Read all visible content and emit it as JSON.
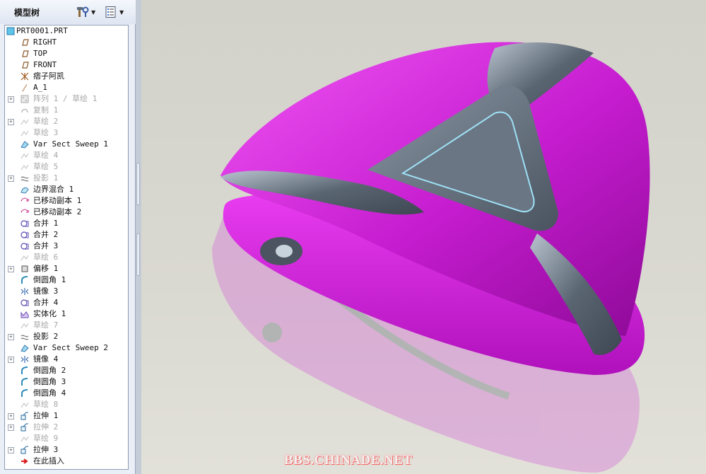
{
  "panel": {
    "title": "模型树",
    "tools": [
      {
        "name": "settings-tool",
        "icon": "hammer-gear-icon"
      },
      {
        "name": "show-tool",
        "icon": "list-icon"
      }
    ]
  },
  "tree": {
    "items": [
      {
        "label": "PRT0001.PRT",
        "icon": "part-icon",
        "dim": false,
        "expand": false,
        "root": true
      },
      {
        "label": "RIGHT",
        "icon": "datum-plane-icon",
        "dim": false,
        "expand": false
      },
      {
        "label": "TOP",
        "icon": "datum-plane-icon",
        "dim": false,
        "expand": false
      },
      {
        "label": "FRONT",
        "icon": "datum-plane-icon",
        "dim": false,
        "expand": false
      },
      {
        "label": "痞子阿凯",
        "icon": "coord-system-icon",
        "dim": false,
        "expand": false
      },
      {
        "label": "A_1",
        "icon": "datum-axis-icon",
        "dim": false,
        "expand": false
      },
      {
        "label": "阵列 1 / 草绘 1",
        "icon": "pattern-icon",
        "dim": true,
        "expand": true
      },
      {
        "label": "复制 1",
        "icon": "copy-icon",
        "dim": true,
        "expand": false
      },
      {
        "label": "草绘 2",
        "icon": "sketch-icon",
        "dim": true,
        "expand": true
      },
      {
        "label": "草绘 3",
        "icon": "sketch-icon",
        "dim": true,
        "expand": false
      },
      {
        "label": "Var Sect Sweep 1",
        "icon": "sweep-icon",
        "dim": false,
        "expand": false
      },
      {
        "label": "草绘 4",
        "icon": "sketch-icon",
        "dim": true,
        "expand": false
      },
      {
        "label": "草绘 5",
        "icon": "sketch-icon",
        "dim": true,
        "expand": false
      },
      {
        "label": "投影 1",
        "icon": "projection-icon",
        "dim": true,
        "expand": true
      },
      {
        "label": "边界混合 1",
        "icon": "boundary-blend-icon",
        "dim": false,
        "expand": false
      },
      {
        "label": "已移动副本 1",
        "icon": "moved-copy-icon",
        "dim": false,
        "expand": false
      },
      {
        "label": "已移动副本 2",
        "icon": "moved-copy-icon",
        "dim": false,
        "expand": false
      },
      {
        "label": "合并 1",
        "icon": "merge-icon",
        "dim": false,
        "expand": false
      },
      {
        "label": "合并 2",
        "icon": "merge-icon",
        "dim": false,
        "expand": false
      },
      {
        "label": "合并 3",
        "icon": "merge-icon",
        "dim": false,
        "expand": false
      },
      {
        "label": "草绘 6",
        "icon": "sketch-icon",
        "dim": true,
        "expand": false
      },
      {
        "label": "偏移 1",
        "icon": "offset-icon",
        "dim": false,
        "expand": true
      },
      {
        "label": "倒圆角 1",
        "icon": "round-icon",
        "dim": false,
        "expand": false
      },
      {
        "label": "镜像 3",
        "icon": "mirror-icon",
        "dim": false,
        "expand": false
      },
      {
        "label": "合并 4",
        "icon": "merge-icon",
        "dim": false,
        "expand": false
      },
      {
        "label": "实体化 1",
        "icon": "solidify-icon",
        "dim": false,
        "expand": false
      },
      {
        "label": "草绘 7",
        "icon": "sketch-icon",
        "dim": true,
        "expand": false
      },
      {
        "label": "投影 2",
        "icon": "projection-icon",
        "dim": false,
        "expand": true
      },
      {
        "label": "Var Sect Sweep 2",
        "icon": "sweep-icon",
        "dim": false,
        "expand": false
      },
      {
        "label": "镜像 4",
        "icon": "mirror-icon",
        "dim": false,
        "expand": true
      },
      {
        "label": "倒圆角 2",
        "icon": "round-icon",
        "dim": false,
        "expand": false
      },
      {
        "label": "倒圆角 3",
        "icon": "round-icon",
        "dim": false,
        "expand": false
      },
      {
        "label": "倒圆角 4",
        "icon": "round-icon",
        "dim": false,
        "expand": false
      },
      {
        "label": "草绘 8",
        "icon": "sketch-icon",
        "dim": true,
        "expand": false
      },
      {
        "label": "拉伸 1",
        "icon": "extrude-icon",
        "dim": false,
        "expand": true
      },
      {
        "label": "拉伸 2",
        "icon": "extrude-icon",
        "dim": true,
        "expand": true
      },
      {
        "label": "草绘 9",
        "icon": "sketch-icon",
        "dim": true,
        "expand": false
      },
      {
        "label": "拉伸 3",
        "icon": "extrude-icon",
        "dim": false,
        "expand": true
      },
      {
        "label": "在此插入",
        "icon": "insert-here-icon",
        "dim": false,
        "expand": false
      }
    ]
  },
  "viewport": {
    "watermark": "BBS.CHINADE.NET",
    "model_colors": {
      "body": "#c010c8",
      "body_light": "#ee44f2",
      "rib": "#4f5966",
      "rib_light": "#aab6c4",
      "edge_highlight": "#8fd9f2"
    }
  }
}
